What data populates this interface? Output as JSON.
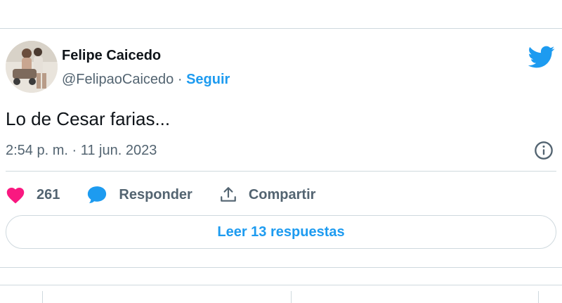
{
  "tweet": {
    "author_name": "Felipe Caicedo",
    "handle": "@FelipaoCaicedo",
    "separator": " · ",
    "follow_label": "Seguir",
    "text": "Lo de Cesar farias...",
    "timestamp": "2:54 p. m. · 11 jun. 2023",
    "likes_count": "261",
    "reply_label": "Responder",
    "share_label": "Compartir",
    "read_replies_label": "Leer 13 respuestas"
  },
  "icons": {
    "brand": "twitter-bird-icon",
    "info": "info-icon",
    "like": "heart-icon",
    "reply": "speech-bubble-icon",
    "share": "share-upload-icon"
  },
  "colors": {
    "brand_blue": "#1d9bf0",
    "like_pink": "#f91880",
    "text_primary": "#0f1419",
    "text_secondary": "#536471",
    "border": "#cfd9de"
  }
}
